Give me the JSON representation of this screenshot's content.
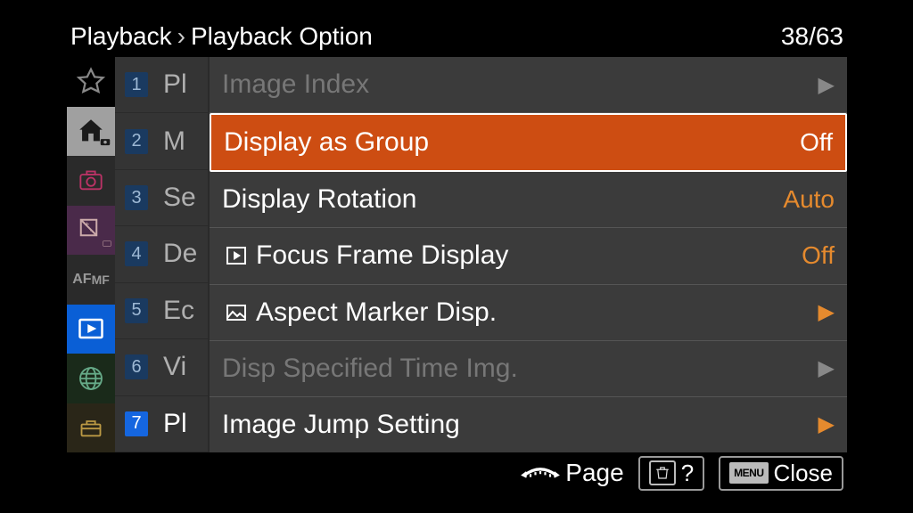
{
  "header": {
    "breadcrumb1": "Playback",
    "breadcrumb_sep": "›",
    "breadcrumb2": "Playback Option",
    "page_counter": "38/63"
  },
  "sidebar": {
    "icons": [
      "star-icon",
      "home-icon",
      "camera-icon",
      "exposure-icon",
      "afmf-icon",
      "play-icon",
      "globe-icon",
      "toolbox-icon"
    ]
  },
  "numcol": {
    "items": [
      "1",
      "2",
      "3",
      "4",
      "5",
      "6",
      "7"
    ],
    "active_index": 6
  },
  "peekcol": {
    "items": [
      "Pl",
      "M",
      "Se",
      "De",
      "Ec",
      "Vi",
      "Pl"
    ],
    "active_index": 6
  },
  "panel": {
    "rows": [
      {
        "label": "Image Index",
        "value": "",
        "arrow": "dim",
        "disabled": true
      },
      {
        "label": "Display as Group",
        "value": "Off",
        "arrow": "",
        "highlight": true
      },
      {
        "label": "Display Rotation",
        "value": "Auto",
        "arrow": ""
      },
      {
        "label": "Focus Frame Display",
        "value": "Off",
        "arrow": "",
        "prefix": "play-box"
      },
      {
        "label": "Aspect Marker Disp.",
        "value": "",
        "arrow": "orange",
        "prefix": "picture"
      },
      {
        "label": "Disp Specified Time Img.",
        "value": "",
        "arrow": "dim",
        "disabled": true
      },
      {
        "label": "Image Jump Setting",
        "value": "",
        "arrow": "orange"
      }
    ]
  },
  "footer": {
    "page_label": "Page",
    "help": "?",
    "menu_label": "MENU",
    "close_label": "Close"
  }
}
